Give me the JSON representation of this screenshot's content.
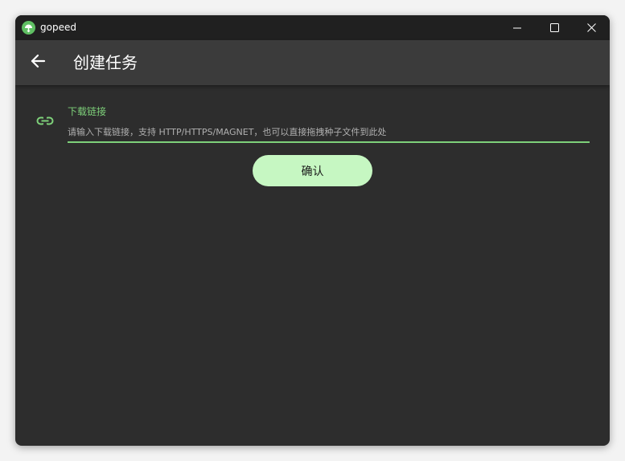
{
  "window": {
    "app_name": "gopeed",
    "logo_icon": "gopeed-logo-icon",
    "controls": {
      "minimize_icon": "minimize-icon",
      "maximize_icon": "maximize-icon",
      "close_icon": "close-icon"
    }
  },
  "appbar": {
    "back_icon": "arrow-left-icon",
    "title": "创建任务"
  },
  "form": {
    "url_field": {
      "icon": "link-icon",
      "label": "下载链接",
      "value": "",
      "placeholder": "请输入下载链接，支持 HTTP/HTTPS/MAGNET，也可以直接拖拽种子文件到此处"
    },
    "confirm_label": "确认"
  },
  "colors": {
    "accent": "#7ed17a",
    "button_bg": "#c6f7c2",
    "window_bg": "#2d2d2d",
    "titlebar_bg": "#202020",
    "appbar_bg": "#3b3b3b"
  }
}
